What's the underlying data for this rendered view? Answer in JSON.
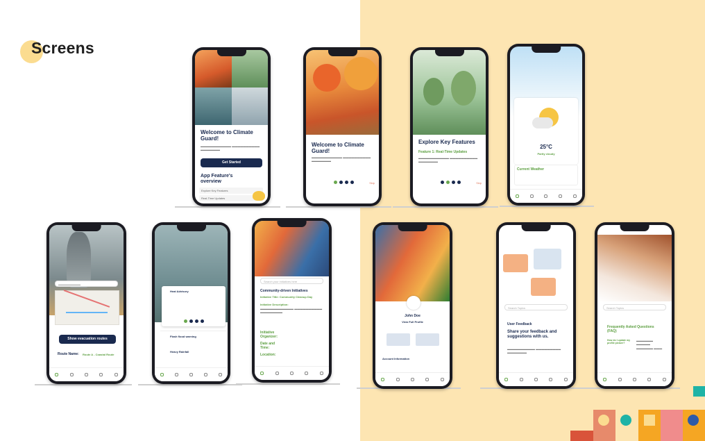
{
  "page": {
    "title": "Screens"
  },
  "colors": {
    "navy": "#1a2a4f",
    "green": "#5b9e3f",
    "accent_bg": "#fde5b2"
  },
  "onboarding": {
    "welcome_title": "Welcome to Climate Guard!",
    "get_started": "Get Started",
    "overview_title": "App Feature's overview",
    "overview_items": [
      "Explore Key Features",
      "Real-Time Updates"
    ],
    "skip": "Skip"
  },
  "features": {
    "title": "Explore Key Features",
    "feature1": "Feature 1: Real-Time Updates"
  },
  "weather": {
    "temp": "25°C",
    "condition": "Partly cloudy",
    "current_title": "Current Weather"
  },
  "evacuation": {
    "show_routes": "Show evacuation routes",
    "route_name_label": "Route Name:",
    "route_name_value": "Route A - Coastal Route"
  },
  "alerts": {
    "heat": "Heat Advisory",
    "flood": "Flash flood warning",
    "rain": "Heavy Rainfall"
  },
  "community": {
    "search_placeholder": "Search your initiatives here",
    "title": "Community-driven Initiatives",
    "initiative_title": "Initiative Title: Community Cleanup Day",
    "description_label": "Initiative Description:",
    "organizer_label": "Initiative Organizer:",
    "date_label": "Date and Time:",
    "location_label": "Location:"
  },
  "profile": {
    "name": "John Doe",
    "view_full": "View Full Profile",
    "account_info": "Account Information"
  },
  "feedback": {
    "search_placeholder": "Search Topics",
    "label": "User Feedback",
    "title": "Share your feedback and suggestions with us."
  },
  "faq": {
    "search_placeholder": "Search Topics",
    "title": "Frequently Asked Questions (FAQ)",
    "q1": "How do I update my profile picture?"
  }
}
